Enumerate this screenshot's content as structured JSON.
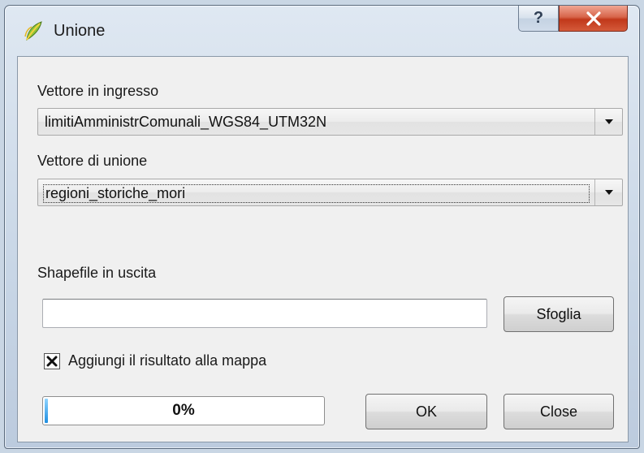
{
  "window": {
    "title": "Unione",
    "help_glyph": "?",
    "close_glyph": "X"
  },
  "form": {
    "input_vector": {
      "label": "Vettore in ingresso",
      "selected": "limitiAmministrComunali_WGS84_UTM32N"
    },
    "join_vector": {
      "label": "Vettore di unione",
      "selected": "regioni_storiche_mori"
    },
    "output_shapefile": {
      "label": "Shapefile in uscita",
      "value": "",
      "browse_label": "Sfoglia"
    },
    "add_to_map": {
      "label": "Aggiungi il risultato alla mappa",
      "checked": true
    },
    "progress": {
      "percent": 0,
      "text": "0%"
    },
    "ok_label": "OK",
    "close_label": "Close"
  },
  "colors": {
    "progress_fill": "#1f8ee0",
    "close_button": "#c1381a"
  }
}
